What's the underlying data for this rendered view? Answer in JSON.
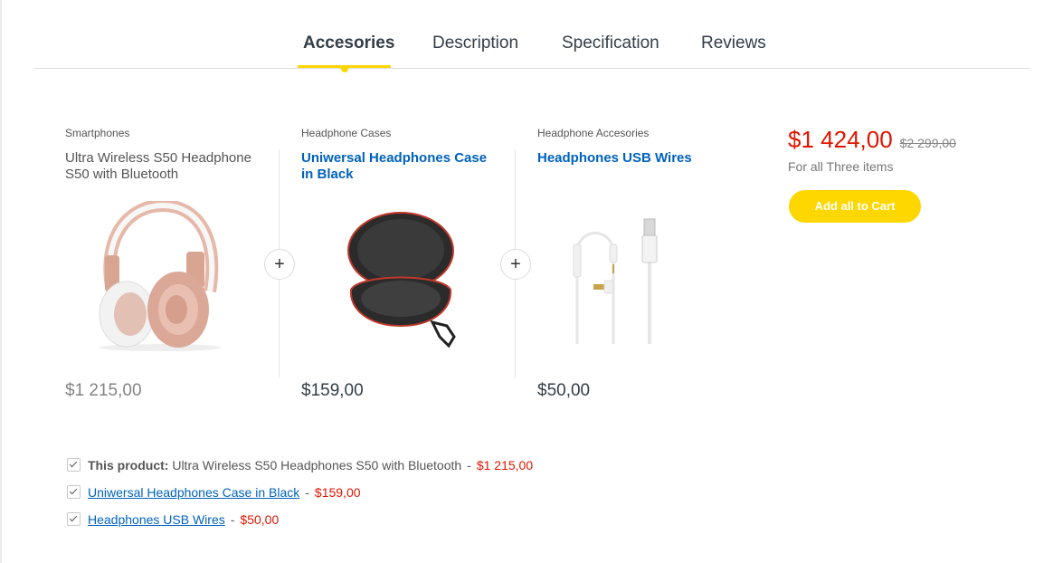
{
  "tabs": [
    {
      "label": "Accesories",
      "active": true
    },
    {
      "label": "Description",
      "active": false
    },
    {
      "label": "Specification",
      "active": false
    },
    {
      "label": "Reviews",
      "active": false
    }
  ],
  "products": [
    {
      "category": "Smartphones",
      "name": "Ultra Wireless S50 Headphone S50 with Bluetooth",
      "price": "$1 215,00",
      "image": "rose-gold-headphones"
    },
    {
      "category": "Headphone Cases",
      "name": "Uniwersal Headphones Case in Black",
      "price": "$159,00",
      "image": "headphones-case"
    },
    {
      "category": "Headphone Accesories",
      "name": "Headphones USB Wires",
      "price": "$50,00",
      "image": "usb-wires"
    }
  ],
  "plus_symbol": "+",
  "total": {
    "price": "$1 424,00",
    "old_price": "$2 299,00",
    "note": "For all Three items",
    "button": "Add all to Cart"
  },
  "checklist": [
    {
      "prefix": "This product:",
      "name": "Ultra Wireless S50 Headphones S50 with Bluetooth",
      "price": "$1 215,00",
      "checked": true
    },
    {
      "prefix": "",
      "name": "Uniwersal Headphones Case in Black",
      "price": "$159,00",
      "checked": true
    },
    {
      "prefix": "",
      "name": "Headphones USB Wires",
      "price": "$50,00",
      "checked": true
    }
  ],
  "separator": "-",
  "colors": {
    "accent": "#fed700",
    "price_red": "#df1500",
    "link_blue": "#0062bd"
  }
}
